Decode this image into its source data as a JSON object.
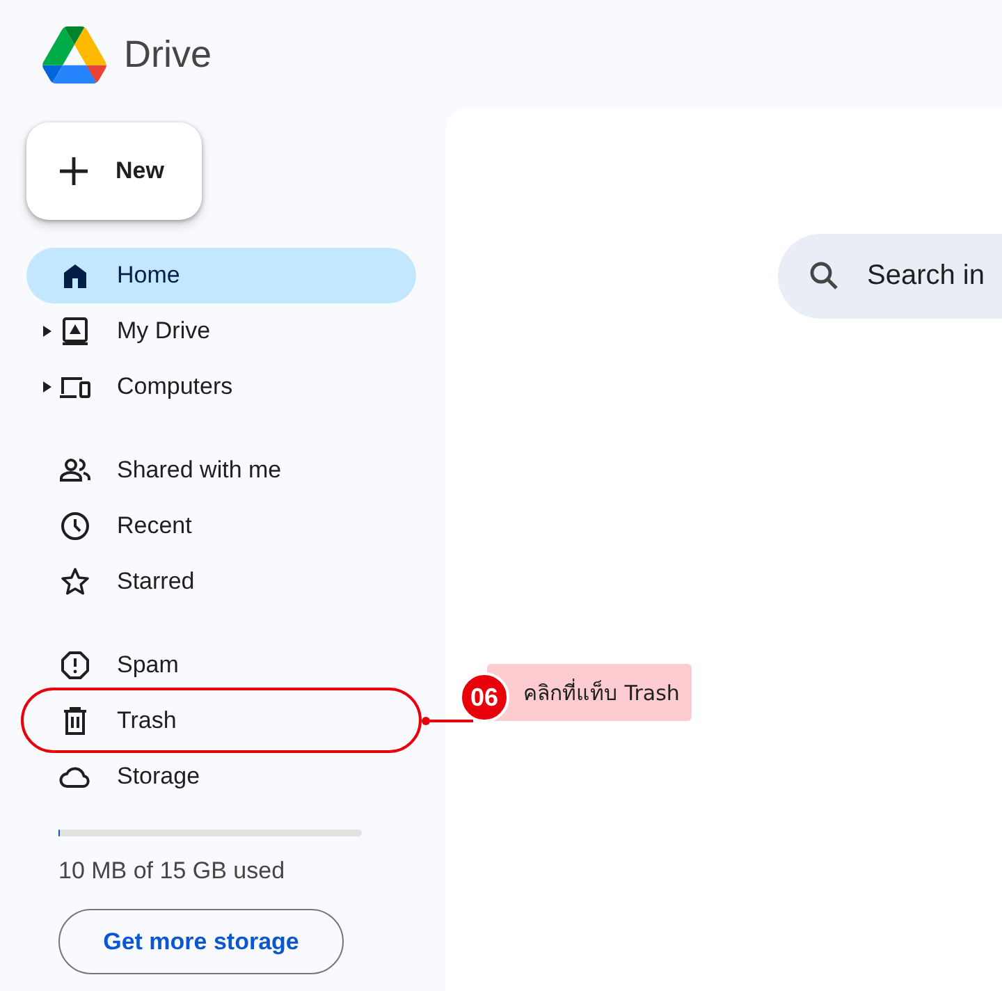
{
  "app": {
    "name": "Drive"
  },
  "new_button": {
    "label": "New"
  },
  "nav_groups": [
    [
      {
        "label": "Home",
        "selected": true
      },
      {
        "label": "My Drive",
        "selected": false,
        "expanded": false
      },
      {
        "label": "Computers",
        "selected": false,
        "expanded": false
      }
    ],
    [
      {
        "label": "Shared with me",
        "selected": false
      },
      {
        "label": "Recent",
        "selected": false
      },
      {
        "label": "Starred",
        "selected": false
      }
    ],
    [
      {
        "label": "Spam",
        "selected": false
      },
      {
        "label": "Trash",
        "selected": false,
        "callout": {
          "number": "06",
          "text": "คลิกที่แท็บ Trash"
        }
      },
      {
        "label": "Storage",
        "selected": false
      }
    ]
  ],
  "storage": {
    "level": 0.0007,
    "usage": "10 MB of 15 GB used",
    "button": "Get more storage"
  },
  "search": {
    "placeholder": "Search in"
  }
}
